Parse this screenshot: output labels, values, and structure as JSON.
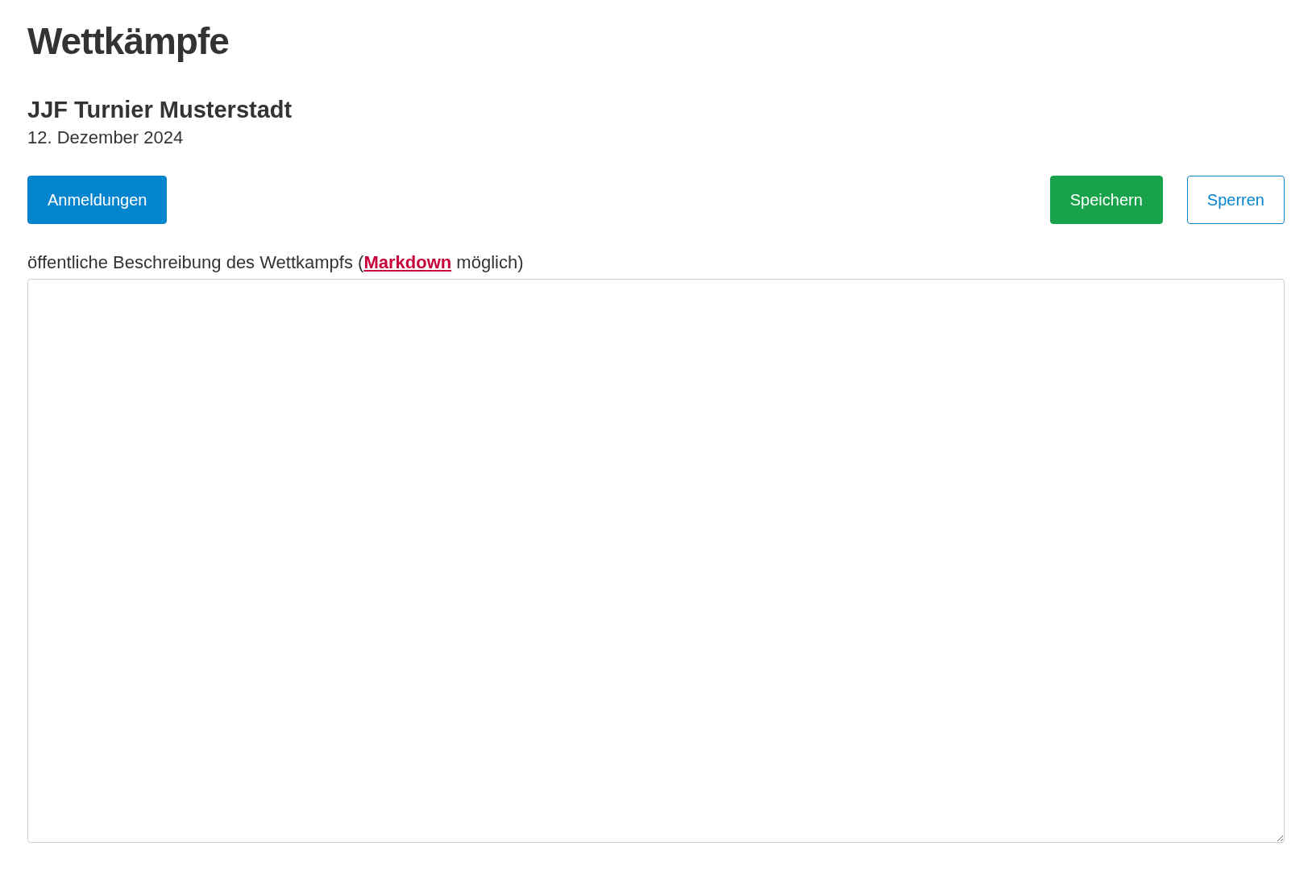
{
  "page_title": "Wettkämpfe",
  "competition": {
    "name": "JJF Turnier Musterstadt",
    "date": "12. Dezember 2024"
  },
  "buttons": [
    {
      "label": "Anmeldungen",
      "kind": "primary"
    },
    {
      "label": "Speichern",
      "kind": "success"
    },
    {
      "label": "Sperren",
      "kind": "outline"
    }
  ],
  "description": {
    "label_before": "öffentliche Beschreibung des Wettkampfs (",
    "link": "Markdown",
    "label_after": " möglich)"
  }
}
